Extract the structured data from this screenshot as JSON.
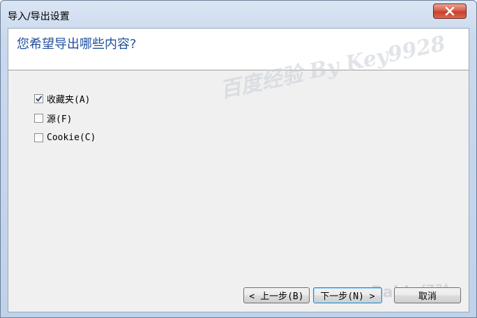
{
  "window": {
    "title": "导入/导出设置"
  },
  "header": {
    "question": "您希望导出哪些内容?"
  },
  "watermark": "百度经验 By Key9928",
  "options": [
    {
      "label": "收藏夹(A)",
      "checked": true
    },
    {
      "label": "源(F)",
      "checked": false
    },
    {
      "label": "Cookie(C)",
      "checked": false
    }
  ],
  "buttons": {
    "back": "< 上一步(B)",
    "next": "下一步(N) >",
    "cancel": "取消"
  },
  "baidu_logo": "Baidu经验",
  "colors": {
    "question_text": "#1e4f9c",
    "close_button": "#c7402b",
    "check_mark": "#2a3f73"
  }
}
